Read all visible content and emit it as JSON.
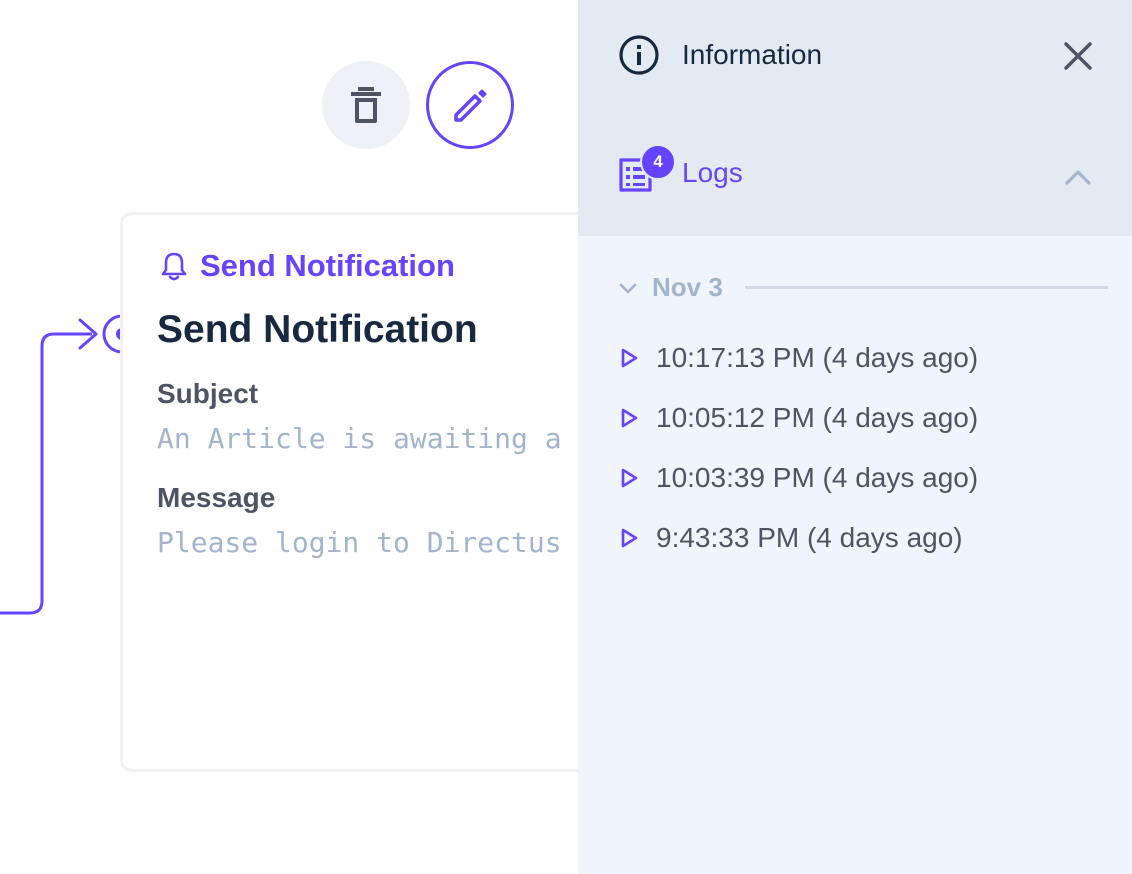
{
  "canvas": {
    "operation": {
      "type_label": "Send Notification",
      "title": "Send Notification",
      "fields": [
        {
          "label": "Subject",
          "value": "An Article is awaiting a"
        },
        {
          "label": "Message",
          "value": "Please login to Directus"
        }
      ]
    },
    "colors": {
      "accent": "#6644ff",
      "card_border": "#f0f2f7",
      "delete_bg": "#eef1f7"
    }
  },
  "sidebar": {
    "info_label": "Information",
    "logs": {
      "label": "Logs",
      "count": "4"
    },
    "date_group": "Nov 3",
    "log_entries": [
      "10:17:13 PM (4 days ago)",
      "10:05:12 PM (4 days ago)",
      "10:03:39 PM (4 days ago)",
      "9:43:33 PM (4 days ago)"
    ],
    "colors": {
      "header_bg": "#e4eaf2",
      "panel_bg": "#f0f4fb",
      "text": "#172940",
      "muted": "#a2b5cd"
    }
  }
}
